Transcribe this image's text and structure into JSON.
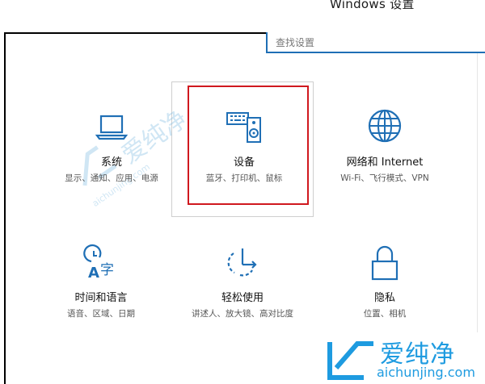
{
  "window": {
    "title": "Windows 设置"
  },
  "search": {
    "placeholder": "查找设置"
  },
  "tiles": [
    {
      "title": "系统",
      "subtitle": "显示、通知、应用、电源",
      "icon": "laptop-icon"
    },
    {
      "title": "设备",
      "subtitle": "蓝牙、打印机、鼠标",
      "icon": "devices-icon"
    },
    {
      "title": "网络和 Internet",
      "subtitle": "Wi-Fi、飞行模式、VPN",
      "icon": "globe-icon"
    },
    {
      "title": "时间和语言",
      "subtitle": "语音、区域、日期",
      "icon": "time-language-icon"
    },
    {
      "title": "轻松使用",
      "subtitle": "讲述人、放大镜、高对比度",
      "icon": "ease-of-access-icon"
    },
    {
      "title": "隐私",
      "subtitle": "位置、相机",
      "icon": "lock-icon"
    }
  ],
  "watermark": {
    "text": "爱纯净",
    "url": "aichunjing.com",
    "url_bottom": "aichunjing.com"
  },
  "colors": {
    "accent": "#1f6fb5",
    "highlight": "#d0181e",
    "watermark": "#1e9be0"
  }
}
